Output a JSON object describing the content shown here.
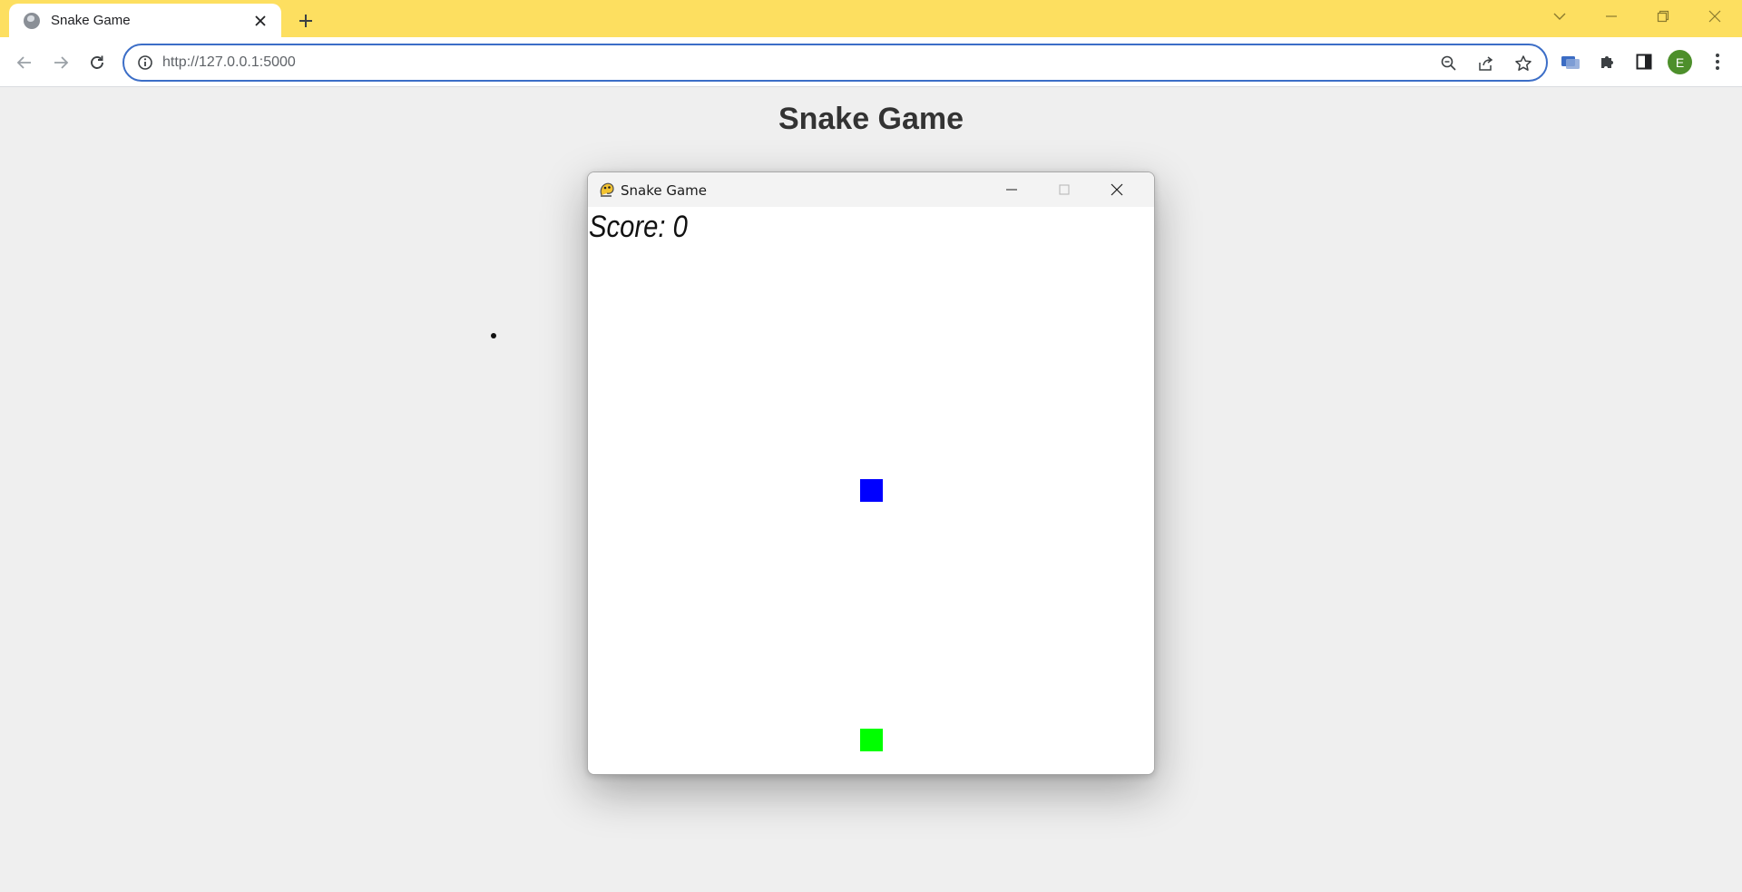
{
  "browser": {
    "tab": {
      "title": "Snake Game",
      "favicon": "globe-icon"
    },
    "address_bar": {
      "url": "http://127.0.0.1:5000",
      "security_icon": "info-icon"
    },
    "profile_initial": "E",
    "theme_color": "#fddf60"
  },
  "page": {
    "heading": "Snake Game"
  },
  "game_window": {
    "title": "Snake Game",
    "app_icon": "pygame-snake-icon",
    "score_text": "Score: 0",
    "snake_color": "#0000ff",
    "food_color": "#00ff00"
  }
}
